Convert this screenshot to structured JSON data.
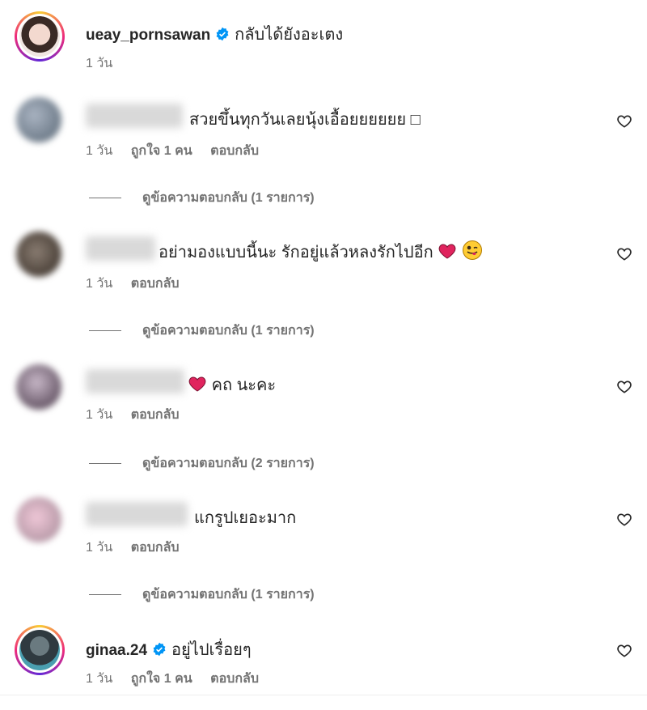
{
  "post": {
    "username": "ueay_pornsawan",
    "caption": "กลับได้ยังอะเตง",
    "time": "1 วัน"
  },
  "comments": [
    {
      "text": "สวยขึ้นทุกวันเลยนุ้งเอื้อยยยยยย ",
      "extra": "□",
      "time": "1 วัน",
      "likes": "ถูกใจ 1 คน",
      "reply": "ตอบกลับ",
      "view_replies": "ดูข้อความตอบกลับ (1 รายการ)"
    },
    {
      "text": "อย่ามองแบบนี้นะ รักอยู่แล้วหลงรักไปอีก",
      "time": "1 วัน",
      "reply": "ตอบกลับ",
      "view_replies": "ดูข้อความตอบกลับ (1 รายการ)"
    },
    {
      "text": "คถ นะคะ",
      "time": "1 วัน",
      "reply": "ตอบกลับ",
      "view_replies": "ดูข้อความตอบกลับ (2 รายการ)"
    },
    {
      "text": "แกรูปเยอะมาก",
      "time": "1 วัน",
      "reply": "ตอบกลับ",
      "view_replies": "ดูข้อความตอบกลับ (1 รายการ)"
    },
    {
      "username": "ginaa.24",
      "text": "อยู่ไปเรื่อยๆ",
      "time": "1 วัน",
      "likes": "ถูกใจ 1 คน",
      "reply": "ตอบกลับ"
    }
  ],
  "colors": {
    "verified": "#0095f6",
    "heart_red": "#e0245e",
    "meta_gray": "#737373"
  }
}
